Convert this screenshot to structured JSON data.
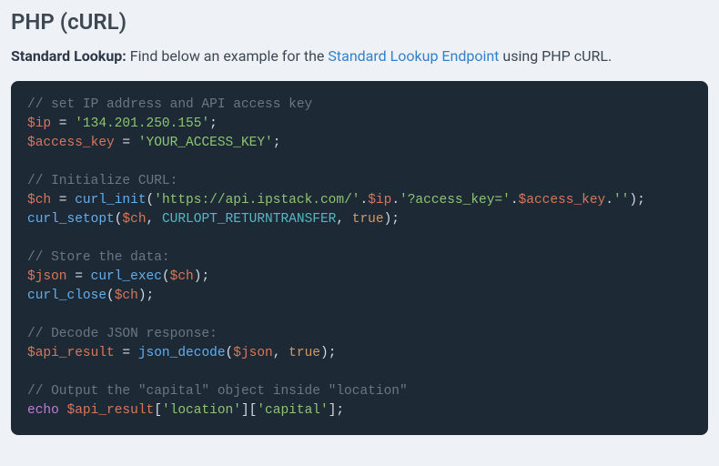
{
  "heading": "PHP (cURL)",
  "description": {
    "lead_bold": "Standard Lookup:",
    "text_before": " Find below an example for the ",
    "link_text": "Standard Lookup Endpoint",
    "text_after": " using PHP cURL."
  },
  "code": {
    "c1": "// set IP address and API access key",
    "v_ip": "$ip",
    "eq": " = ",
    "ip_str": "'134.201.250.155'",
    "semi": ";",
    "v_ak": "$access_key",
    "ak_str": "'YOUR_ACCESS_KEY'",
    "c2": "// Initialize CURL:",
    "v_ch": "$ch",
    "f_init": "curl_init",
    "paren_o": "(",
    "paren_c": ")",
    "url_str": "'https://api.ipstack.com/'",
    "dot": ".",
    "qs_str": "'?access_key='",
    "empty_str": "''",
    "f_setopt": "curl_setopt",
    "comma": ", ",
    "const_rt": "CURLOPT_RETURNTRANSFER",
    "true": "true",
    "c3": "// Store the data:",
    "v_json": "$json",
    "f_exec": "curl_exec",
    "f_close": "curl_close",
    "c4": "// Decode JSON response:",
    "v_res": "$api_result",
    "f_decode": "json_decode",
    "c5": "// Output the \"capital\" object inside \"location\"",
    "kw_echo": "echo",
    "sp": " ",
    "br_o": "[",
    "br_c": "]",
    "loc_str": "'location'",
    "cap_str": "'capital'"
  }
}
